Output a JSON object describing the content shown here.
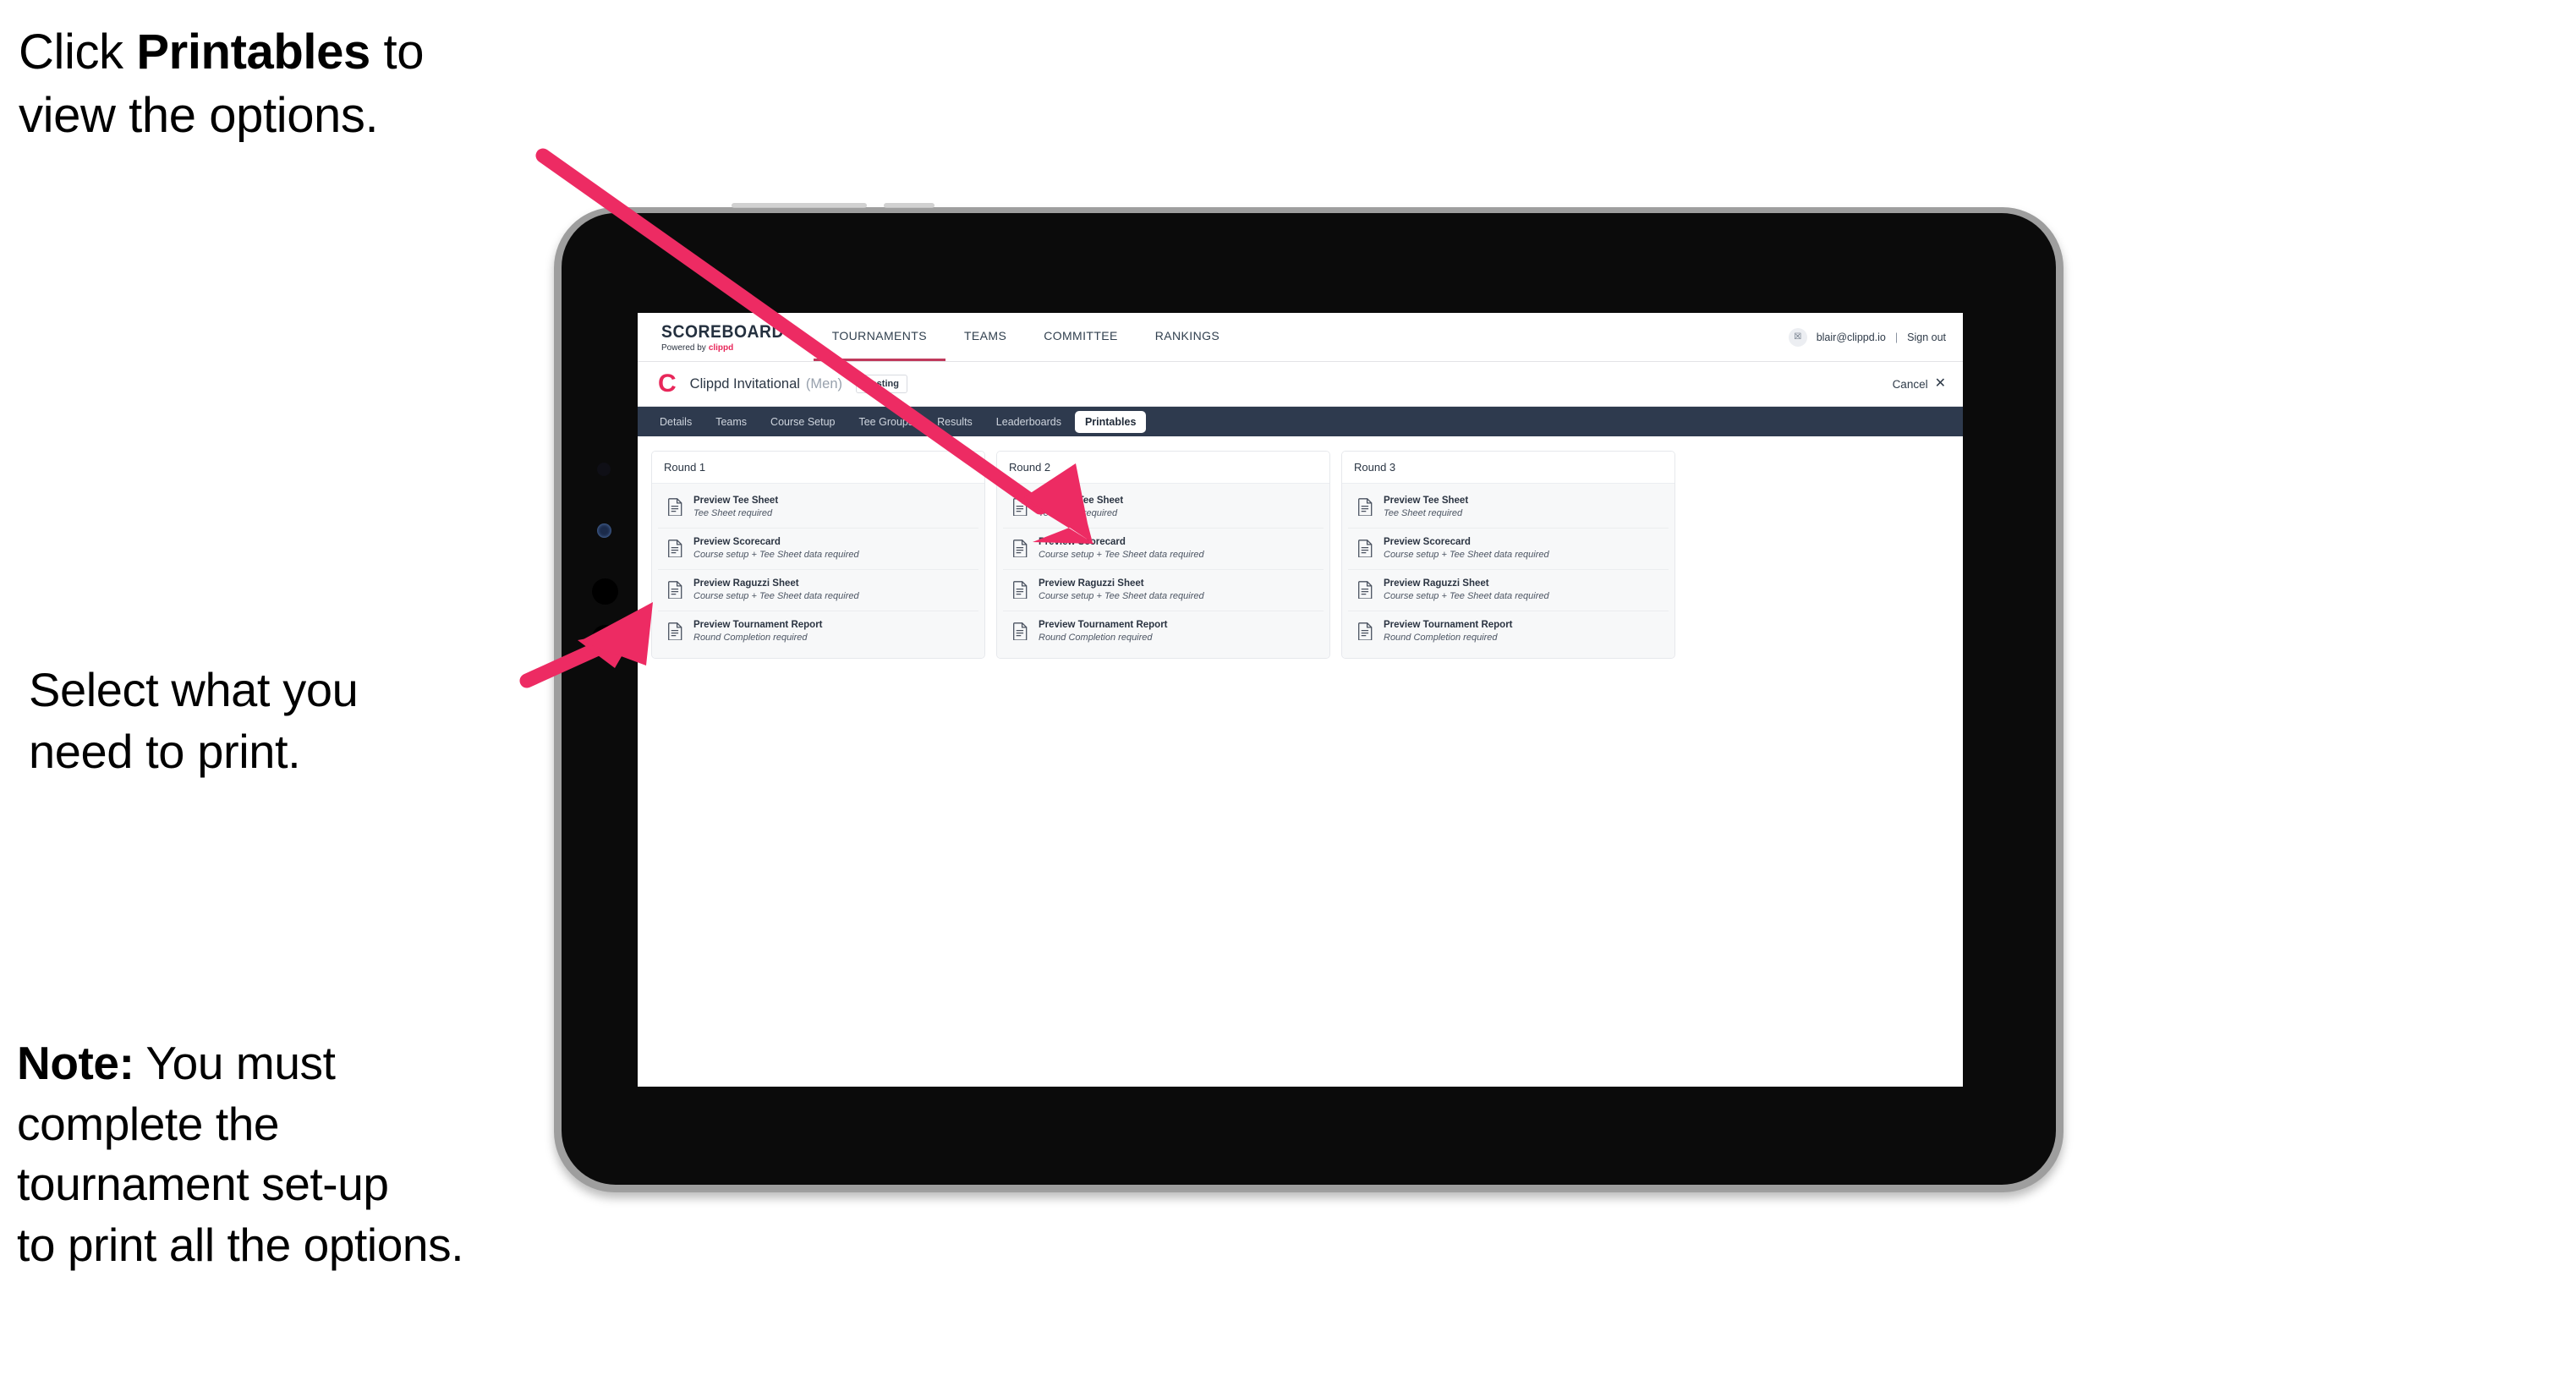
{
  "annotations": {
    "callout_1": {
      "prefix": "Click ",
      "bold": "Printables",
      "suffix": " to\nview the options."
    },
    "callout_2": {
      "text": "Select what you\n need to print."
    },
    "callout_3": {
      "prefix": "",
      "bold": "Note:",
      "suffix": " You must\ncomplete the\ntournament set-up\nto print all the options."
    }
  },
  "app": {
    "brand": {
      "title": "SCOREBOARD",
      "powered_prefix": "Powered by",
      "powered_name": "clippd"
    },
    "top_nav": [
      {
        "label": "TOURNAMENTS",
        "active": true
      },
      {
        "label": "TEAMS",
        "active": false
      },
      {
        "label": "COMMITTEE",
        "active": false
      },
      {
        "label": "RANKINGS",
        "active": false
      }
    ],
    "account": {
      "avatar_glyph": "☒",
      "email": "blair@clippd.io",
      "separator": "|",
      "sign_out": "Sign out"
    },
    "tournament": {
      "logo_letter": "C",
      "name": "Clippd Invitational",
      "gender": "(Men)",
      "status_chip": "Hosting",
      "cancel_label": "Cancel",
      "cancel_icon": "✕"
    },
    "tabs": [
      {
        "label": "Details",
        "active": false
      },
      {
        "label": "Teams",
        "active": false
      },
      {
        "label": "Course Setup",
        "active": false
      },
      {
        "label": "Tee Groups",
        "active": false
      },
      {
        "label": "Results",
        "active": false
      },
      {
        "label": "Leaderboards",
        "active": false
      },
      {
        "label": "Printables",
        "active": true
      }
    ],
    "rounds": [
      {
        "title": "Round 1",
        "items": [
          {
            "title": "Preview Tee Sheet",
            "subtitle": "Tee Sheet required"
          },
          {
            "title": "Preview Scorecard",
            "subtitle": "Course setup + Tee Sheet data required"
          },
          {
            "title": "Preview Raguzzi Sheet",
            "subtitle": "Course setup + Tee Sheet data required"
          },
          {
            "title": "Preview Tournament Report",
            "subtitle": "Round Completion required"
          }
        ]
      },
      {
        "title": "Round 2",
        "items": [
          {
            "title": "Preview Tee Sheet",
            "subtitle": "Tee Sheet required"
          },
          {
            "title": "Preview Scorecard",
            "subtitle": "Course setup + Tee Sheet data required"
          },
          {
            "title": "Preview Raguzzi Sheet",
            "subtitle": "Course setup + Tee Sheet data required"
          },
          {
            "title": "Preview Tournament Report",
            "subtitle": "Round Completion required"
          }
        ]
      },
      {
        "title": "Round 3",
        "items": [
          {
            "title": "Preview Tee Sheet",
            "subtitle": "Tee Sheet required"
          },
          {
            "title": "Preview Scorecard",
            "subtitle": "Course setup + Tee Sheet data required"
          },
          {
            "title": "Preview Raguzzi Sheet",
            "subtitle": "Course setup + Tee Sheet data required"
          },
          {
            "title": "Preview Tournament Report",
            "subtitle": "Round Completion required"
          }
        ]
      }
    ]
  },
  "colors": {
    "accent_pink": "#ed2b63",
    "brand_pink": "#e8275a",
    "tabbar_navy": "#2e3a4e",
    "text_dark": "#2b3644",
    "device_bezel": "#9e9e9e"
  }
}
